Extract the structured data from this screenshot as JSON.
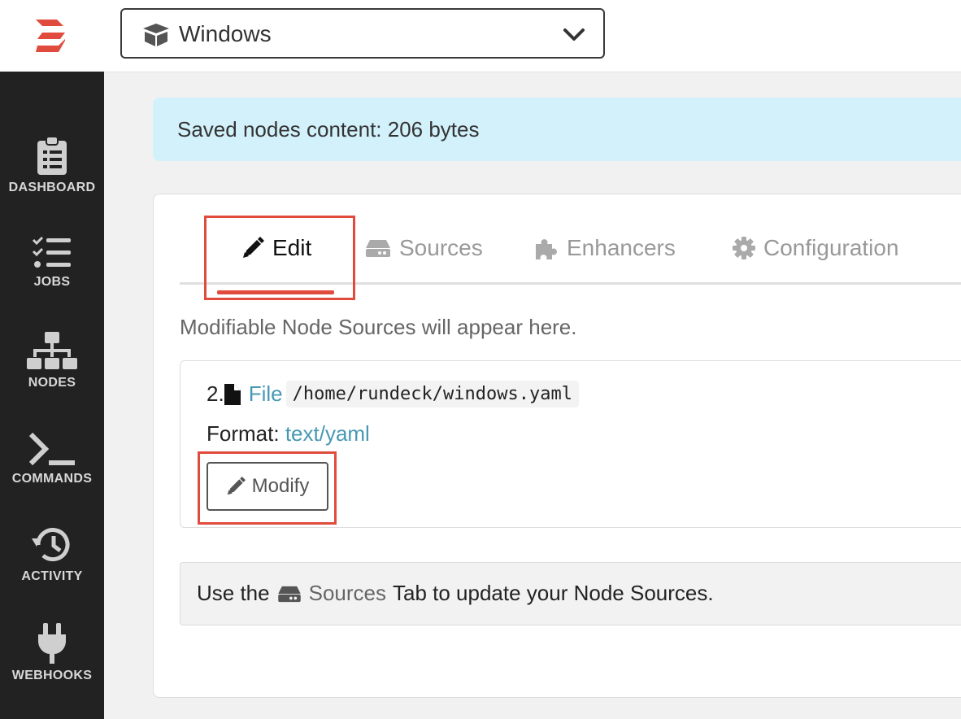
{
  "project": {
    "name": "Windows"
  },
  "sidebar": {
    "items": [
      {
        "label": "DASHBOARD"
      },
      {
        "label": "JOBS"
      },
      {
        "label": "NODES"
      },
      {
        "label": "COMMANDS"
      },
      {
        "label": "ACTIVITY"
      },
      {
        "label": "WEBHOOKS"
      }
    ]
  },
  "alert": {
    "text": "Saved nodes content: 206 bytes"
  },
  "tabs": [
    {
      "label": "Edit",
      "icon": "pencil-icon",
      "active": true
    },
    {
      "label": "Sources",
      "icon": "hdd-icon"
    },
    {
      "label": "Enhancers",
      "icon": "puzzle-icon"
    },
    {
      "label": "Configuration",
      "icon": "gear-icon"
    }
  ],
  "edit": {
    "description": "Modifiable Node Sources will appear here.",
    "source": {
      "index": "2.",
      "type": "File",
      "path": "/home/rundeck/windows.yaml",
      "format_label": "Format:",
      "format": "text/yaml",
      "modify_label": "Modify"
    },
    "hint": {
      "before": "Use the",
      "link": "Sources",
      "after": "Tab to update your Node Sources."
    }
  },
  "colors": {
    "accent": "#e04b3d",
    "link": "#4798b4",
    "sidebar": "#222222",
    "alert_bg": "#d3f1fb"
  }
}
